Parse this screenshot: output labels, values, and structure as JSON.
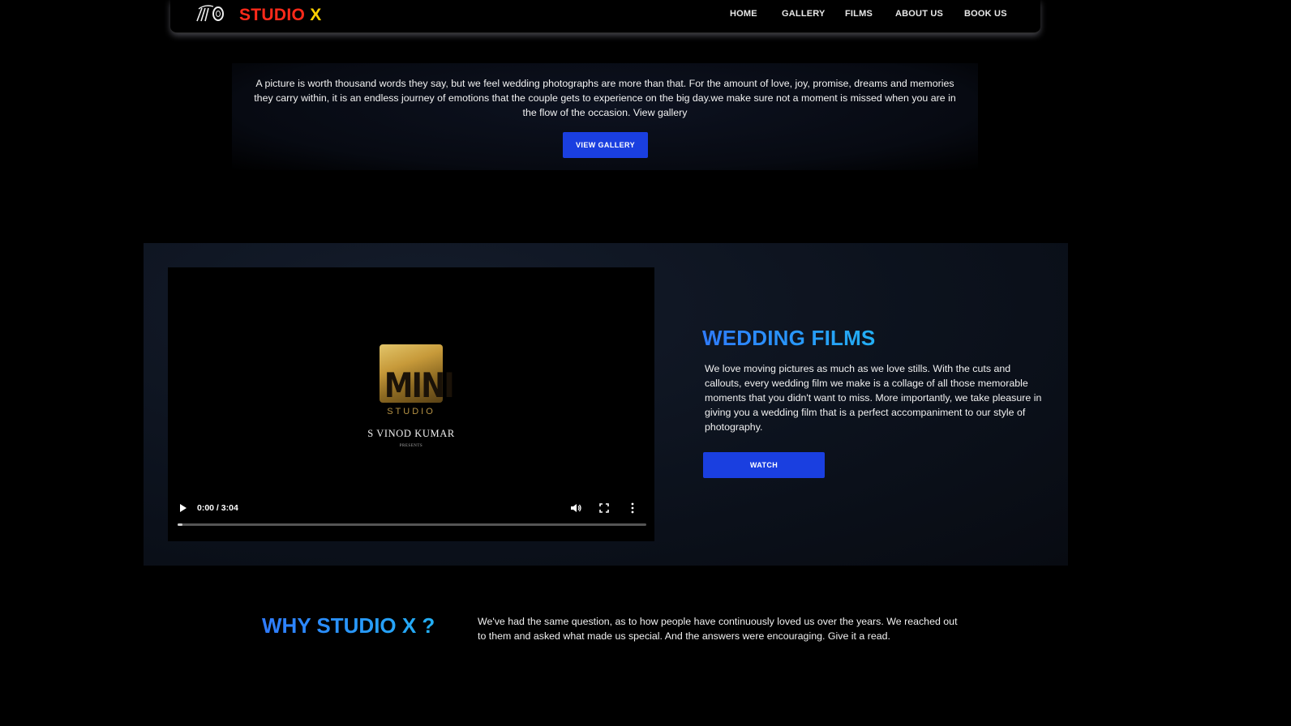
{
  "brand": {
    "studio": "STUDIO",
    "x": "X"
  },
  "nav": {
    "items": [
      "HOME",
      "GALLERY",
      "FILMS",
      "ABOUT US",
      "BOOK US"
    ]
  },
  "intro": {
    "text": "A picture is worth thousand words they say, but we feel wedding photographs are more than that. For the amount of love, joy, promise, dreams and memories they carry within, it is an endless journey of emotions that the couple gets to experience on the big day.we make sure not a moment is missed when you are in the flow of the occasion. View gallery",
    "button": "VIEW GALLERY"
  },
  "video": {
    "logo_word": "MINI",
    "logo_sub": "STUDIO",
    "presenter": "S VINOD KUMAR",
    "presents": "PRESENTS",
    "time": "0:00 / 3:04",
    "progress": 0.01
  },
  "films": {
    "title": "WEDDING FILMS",
    "text": "We love moving pictures as much as we love stills. With the cuts and callouts, every wedding film we make is a collage of all those memorable moments that you didn't want to miss. More importantly, we take pleasure in giving you a wedding film that is a perfect accompaniment to our style of photography.",
    "button": "WATCH"
  },
  "why": {
    "title": "WHY STUDIO X ?",
    "text": "We've had the same question, as to how people have continuously loved us over the years. We reached out to them and asked what made us special. And the answers were encouraging. Give it a read."
  },
  "colors": {
    "accent": "#1a3fe0",
    "brand_red": "#ff2a1a",
    "brand_yellow": "#ffd000",
    "title_gradient_start": "#2f7bff",
    "title_gradient_end": "#23b0f5"
  }
}
